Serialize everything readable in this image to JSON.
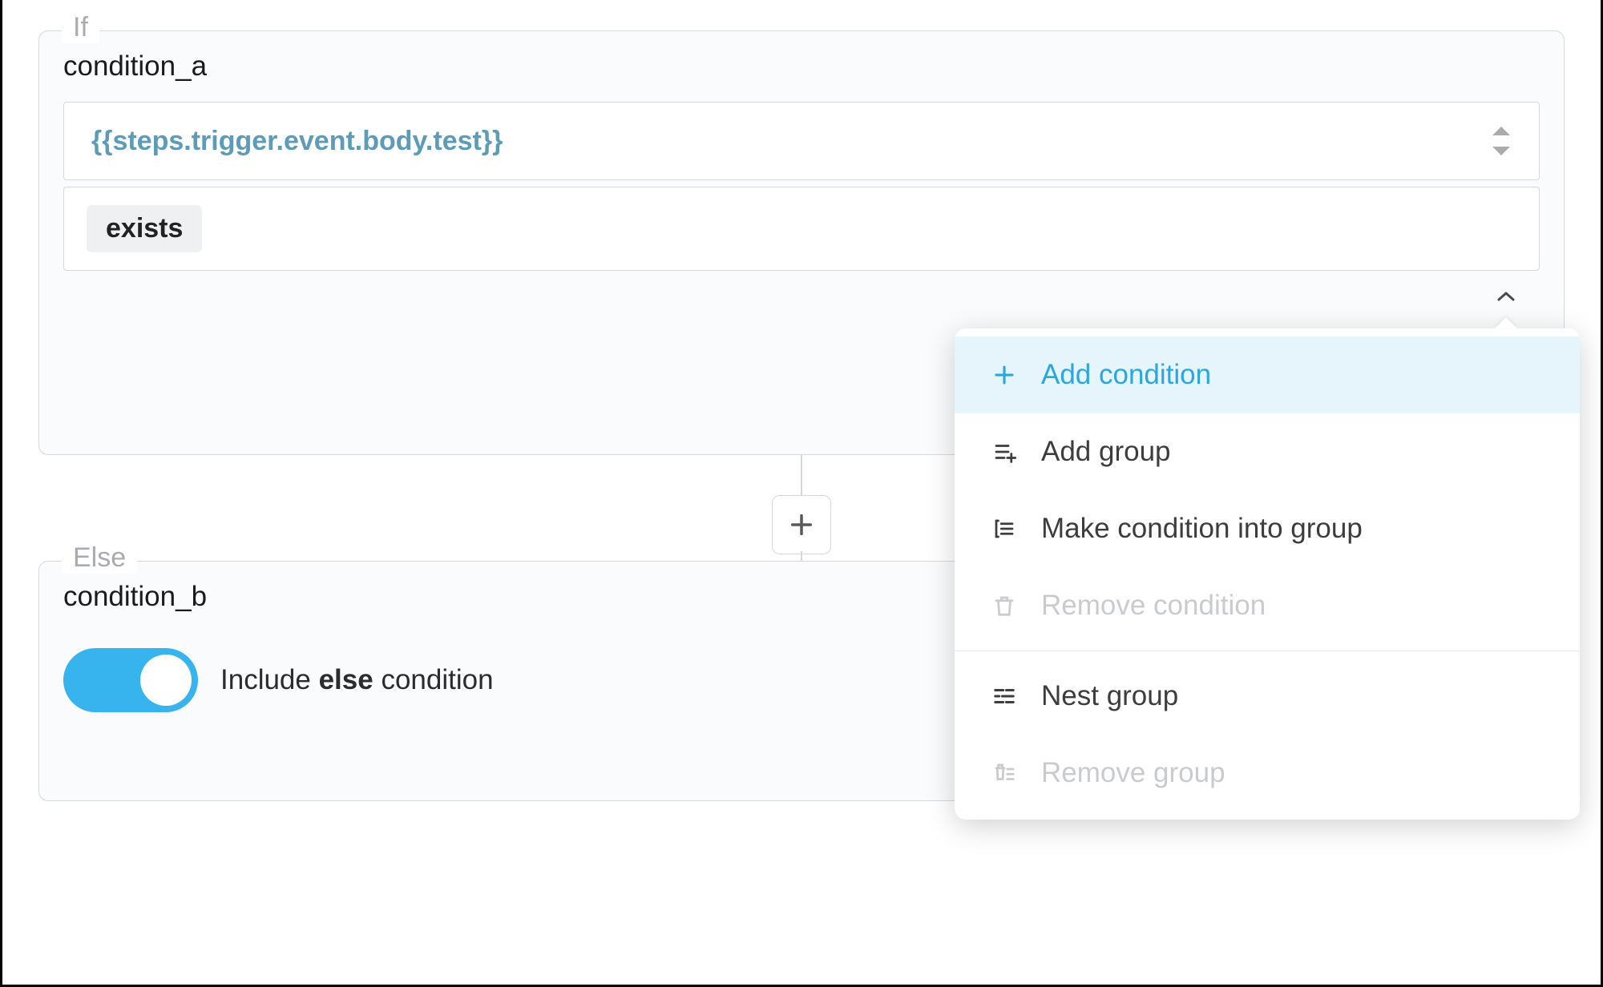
{
  "if_block": {
    "legend": "If",
    "name": "condition_a",
    "expression": "{{steps.trigger.event.body.test}}",
    "operator": "exists"
  },
  "else_block": {
    "legend": "Else",
    "name": "condition_b",
    "toggle_prefix": "Include ",
    "toggle_bold": "else",
    "toggle_suffix": " condition",
    "toggle_on": true
  },
  "menu": {
    "items": [
      {
        "label": "Add condition",
        "highlight": true,
        "disabled": false
      },
      {
        "label": "Add group",
        "highlight": false,
        "disabled": false
      },
      {
        "label": "Make condition into group",
        "highlight": false,
        "disabled": false
      },
      {
        "label": "Remove condition",
        "highlight": false,
        "disabled": true
      }
    ],
    "group_items": [
      {
        "label": "Nest group",
        "highlight": false,
        "disabled": false
      },
      {
        "label": "Remove group",
        "highlight": false,
        "disabled": true
      }
    ]
  }
}
